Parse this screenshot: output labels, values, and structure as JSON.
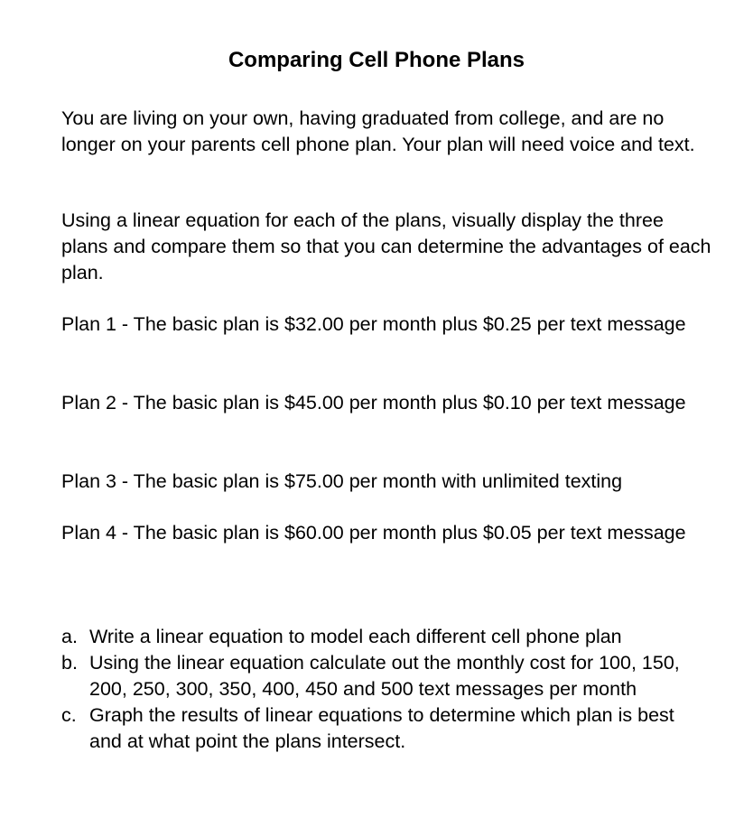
{
  "document": {
    "title": "Comparing Cell Phone Plans",
    "intro_paragraph": "You are living on your own, having graduated from college, and are no longer on your parents cell phone plan.  Your plan will need voice and text.",
    "instructions_paragraph": "Using a linear equation for each of the plans, visually display the three plans and compare them so that you can determine the advantages of each plan.",
    "plans": [
      "Plan 1 - The basic plan is $32.00 per month plus $0.25 per text message",
      "Plan 2 - The basic plan is $45.00 per month plus $0.10 per text message",
      "Plan 3 - The basic plan is $75.00 per month with unlimited texting",
      "Plan 4 - The basic plan is $60.00 per month plus $0.05 per text message"
    ],
    "tasks": [
      {
        "marker": "a.",
        "text": "Write a linear equation to model each different cell phone plan"
      },
      {
        "marker": "b.",
        "text": "Using the linear equation calculate out the monthly cost for 100, 150, 200, 250, 300, 350, 400, 450 and 500 text messages per month"
      },
      {
        "marker": "c.",
        "text": "Graph the results of linear equations to determine which plan is best and at what point the plans intersect."
      }
    ]
  }
}
